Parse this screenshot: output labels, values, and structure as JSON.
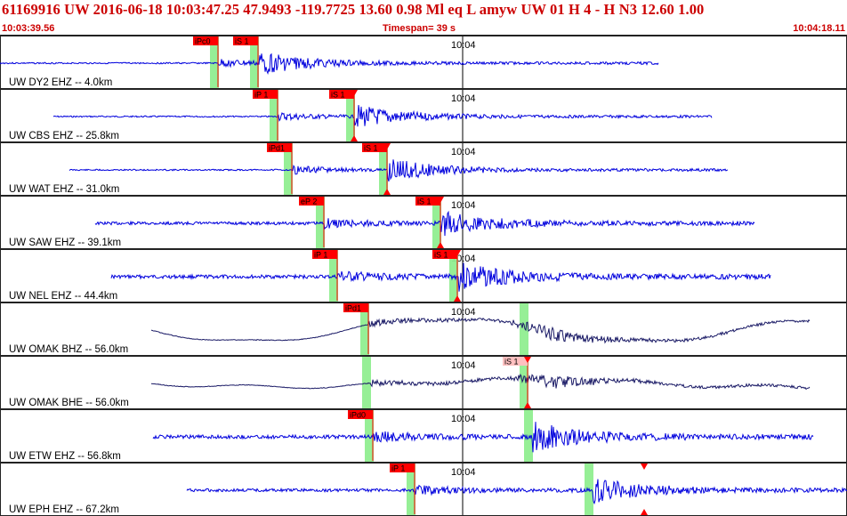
{
  "header": {
    "title": "61169916 UW 2016-06-18 10:03:47.25   47.9493 -119.7725  13.60  0.98 Ml  eq  L amyw     UW 01  H   4  -  H N3    12.60  1.00",
    "start_time": "10:03:39.56",
    "timespan": "Timespan=  39 s",
    "end_time": "10:04:18.11"
  },
  "colors": {
    "trace_blue": "#0000dd",
    "trace_dark": "#1a1a66",
    "pick_red": "#ff0000",
    "pick_pink": "#ffc0c0",
    "pick_green": "#90ee90",
    "title_red": "#cc0000"
  },
  "panels": [
    {
      "label": "UW DY2 EHZ -- 4.0km",
      "time_mark": "10:04",
      "color": "blue",
      "picks": [
        {
          "label": "iPc0",
          "t": 0.257,
          "style": "red",
          "marker": false
        },
        {
          "label": "iS 1",
          "t": 0.305,
          "style": "red",
          "marker": false
        }
      ]
    },
    {
      "label": "UW CBS EHZ -- 25.8km",
      "time_mark": "10:04",
      "color": "blue",
      "picks": [
        {
          "label": "iP 1",
          "t": 0.328,
          "style": "red",
          "marker": false
        },
        {
          "label": "iS 1",
          "t": 0.418,
          "style": "red",
          "marker": true
        }
      ]
    },
    {
      "label": "UW WAT EHZ -- 31.0km",
      "time_mark": "10:04",
      "color": "blue",
      "picks": [
        {
          "label": "iPd1",
          "t": 0.345,
          "style": "red",
          "marker": false
        },
        {
          "label": "iS 1",
          "t": 0.457,
          "style": "red",
          "marker": true
        }
      ]
    },
    {
      "label": "UW SAW EHZ -- 39.1km",
      "time_mark": "10:04",
      "color": "blue",
      "picks": [
        {
          "label": "eP 2",
          "t": 0.382,
          "style": "red",
          "marker": false
        },
        {
          "label": "iS 1",
          "t": 0.52,
          "style": "red",
          "marker": true
        }
      ]
    },
    {
      "label": "UW NEL EHZ -- 44.4km",
      "time_mark": "10:04",
      "color": "blue",
      "picks": [
        {
          "label": "iP 1",
          "t": 0.398,
          "style": "red",
          "marker": false
        },
        {
          "label": "iS 1",
          "t": 0.54,
          "style": "red",
          "marker": true
        }
      ]
    },
    {
      "label": "UW OMAK BHZ -- 56.0km",
      "time_mark": "10:04",
      "color": "dark",
      "picks": [
        {
          "label": "iPd1",
          "t": 0.435,
          "style": "red",
          "marker": false
        },
        {
          "label": "",
          "t": 0.623,
          "style": "none",
          "marker": false
        }
      ]
    },
    {
      "label": "UW OMAK BHE -- 56.0km",
      "time_mark": "10:04",
      "color": "dark",
      "picks": [
        {
          "label": "",
          "t": 0.437,
          "style": "none",
          "marker": false
        },
        {
          "label": "iS 1",
          "t": 0.623,
          "style": "pink",
          "marker": true
        }
      ]
    },
    {
      "label": "UW ETW EHZ -- 56.8km",
      "time_mark": "10:04",
      "color": "blue",
      "picks": [
        {
          "label": "iPd0",
          "t": 0.44,
          "style": "red",
          "marker": false
        },
        {
          "label": "",
          "t": 0.628,
          "style": "none",
          "marker": false
        }
      ]
    },
    {
      "label": "UW EPH EHZ -- 67.2km",
      "time_mark": "10:04",
      "color": "blue",
      "picks": [
        {
          "label": "iP 1",
          "t": 0.49,
          "style": "red",
          "marker": false
        },
        {
          "label": "",
          "t": 0.7,
          "style": "none",
          "marker": false
        },
        {
          "label": "",
          "t": 0.76,
          "style": "marker-only",
          "marker": true
        }
      ]
    }
  ]
}
